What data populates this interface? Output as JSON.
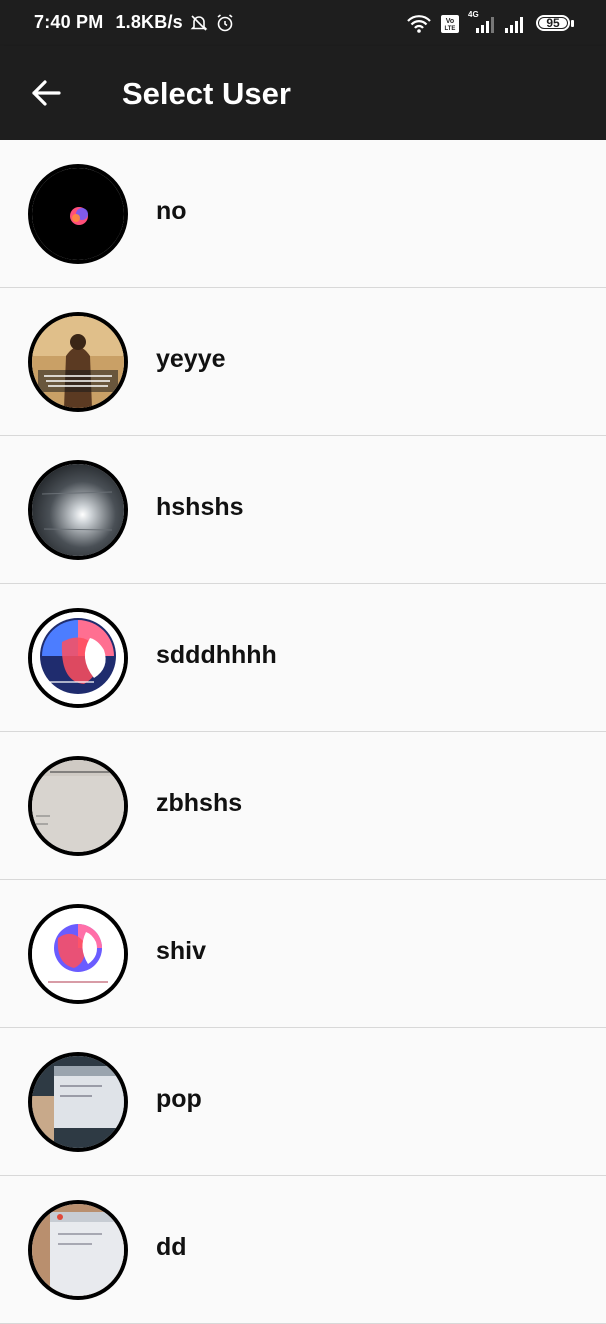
{
  "status_bar": {
    "time": "7:40 PM",
    "speed": "1.8KB/s",
    "network": "4G",
    "volte": "Vo LTE",
    "battery": "95"
  },
  "app_bar": {
    "title": "Select User",
    "back_icon": "arrow-left-icon"
  },
  "users": [
    {
      "name": "no"
    },
    {
      "name": "yeyye"
    },
    {
      "name": "hshshs"
    },
    {
      "name": "sdddhhhh"
    },
    {
      "name": "zbhshs"
    },
    {
      "name": "shiv"
    },
    {
      "name": "pop"
    },
    {
      "name": "dd"
    }
  ],
  "colors": {
    "app_bar": "#1e1e1e",
    "background": "#fafafa",
    "divider": "#d8d8d8"
  }
}
